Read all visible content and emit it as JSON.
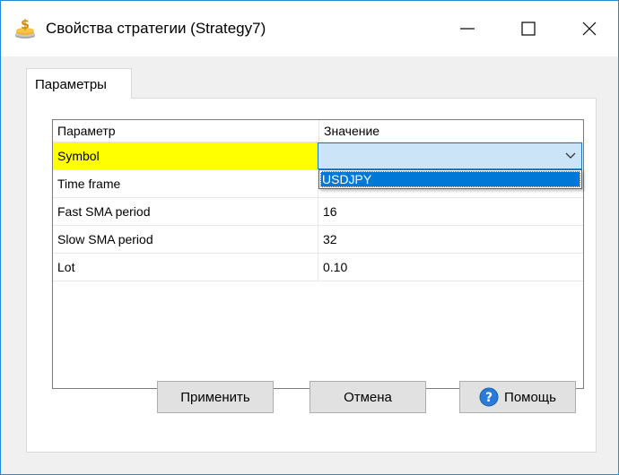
{
  "window": {
    "title": "Свойства стратегии (Strategy7)",
    "icon": "strategy-coins-icon",
    "controls": {
      "minimize": "minimize-icon",
      "maximize": "maximize-icon",
      "close": "close-icon"
    }
  },
  "tabs": [
    {
      "label": "Параметры",
      "active": true
    }
  ],
  "grid": {
    "columns": [
      "Параметр",
      "Значение"
    ],
    "rows": [
      {
        "name": "Symbol",
        "value": "",
        "selected": true
      },
      {
        "name": "Time frame",
        "value": ""
      },
      {
        "name": "Fast SMA period",
        "value": "16"
      },
      {
        "name": "Slow SMA period",
        "value": "32"
      },
      {
        "name": "Lot",
        "value": "0.10"
      }
    ],
    "dropdown_options": [
      "USDJPY"
    ]
  },
  "buttons": {
    "apply": "Применить",
    "cancel": "Отмена",
    "help": "Помощь"
  },
  "colors": {
    "accent": "#0078d7",
    "selected_row": "#ffff00",
    "combo_bg": "#cce4f7",
    "window_border": "#1f8ad8"
  }
}
